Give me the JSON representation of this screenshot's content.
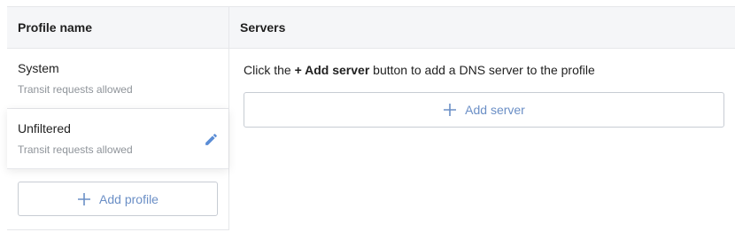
{
  "table": {
    "columns": {
      "profile_name": "Profile name",
      "servers": "Servers"
    }
  },
  "profiles": [
    {
      "name": "System",
      "subtitle": "Transit requests allowed"
    },
    {
      "name": "Unfiltered",
      "subtitle": "Transit requests allowed"
    }
  ],
  "actions": {
    "add_profile_label": "Add profile",
    "add_server_label": "Add server"
  },
  "servers_panel": {
    "hint_prefix": "Click the ",
    "hint_bold": "+ Add server",
    "hint_suffix": " button to add a DNS server to the profile"
  },
  "icons": {
    "edit": "pencil-icon",
    "add": "plus-icon"
  },
  "colors": {
    "accent": "#6b8fc6",
    "edit_icon": "#5b8dd6",
    "header_bg": "#f5f6f8",
    "subtitle": "#8f949a",
    "border": "#e6e7ea"
  }
}
